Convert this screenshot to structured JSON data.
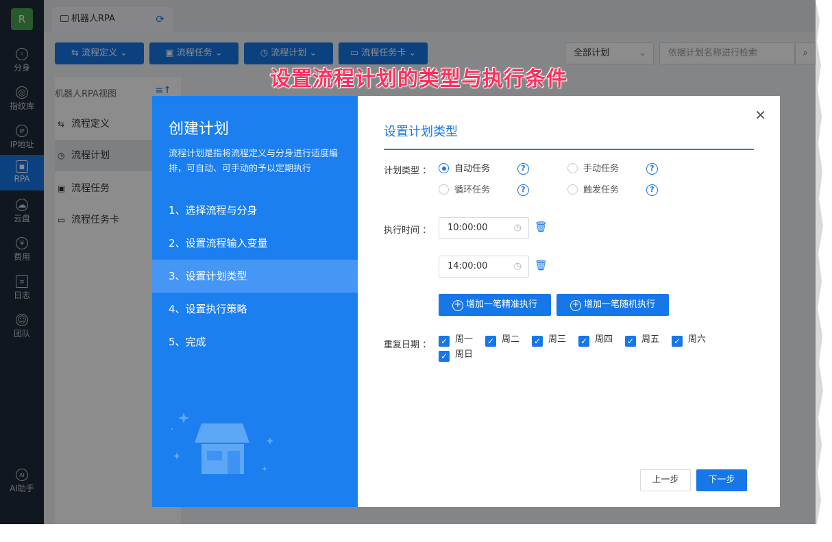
{
  "rail": {
    "logo": "R",
    "items": [
      {
        "label": "分身",
        "icon": "globe-icon"
      },
      {
        "label": "指纹库",
        "icon": "fingerprint-icon"
      },
      {
        "label": "IP地址",
        "icon": "ip-icon"
      },
      {
        "label": "RPA",
        "icon": "robot-icon",
        "active": true
      },
      {
        "label": "云盘",
        "icon": "cloud-icon"
      },
      {
        "label": "费用",
        "icon": "yen-icon"
      },
      {
        "label": "日志",
        "icon": "log-icon"
      },
      {
        "label": "团队",
        "icon": "team-icon"
      },
      {
        "label": "AI助手",
        "icon": "ai-icon"
      }
    ]
  },
  "tab": {
    "label": "机器人RPA"
  },
  "toolbar": {
    "flow_def": "流程定义",
    "flow_task": "流程任务",
    "flow_plan": "流程计划",
    "flow_card": "流程任务卡",
    "plan_filter": "全部计划",
    "search_placeholder": "依据计划名称进行检索"
  },
  "tree": {
    "title": "机器人RPA视图",
    "items": [
      "流程定义",
      "流程计划",
      "流程任务",
      "流程任务卡"
    ]
  },
  "banner": "设置流程计划的类型与执行条件",
  "modal": {
    "title": "创建计划",
    "desc": "流程计划是指将流程定义与分身进行适度编排，可自动、可手动的予以定期执行",
    "steps": [
      "1、选择流程与分身",
      "2、设置流程输入变量",
      "3、设置计划类型",
      "4、设置执行策略",
      "5、完成"
    ],
    "current_step": 3,
    "section_title": "设置计划类型",
    "plan_type_label": "计划类型",
    "plan_types": [
      {
        "label": "自动任务",
        "selected": true
      },
      {
        "label": "手动任务",
        "selected": false
      },
      {
        "label": "循环任务",
        "selected": false
      },
      {
        "label": "触发任务",
        "selected": false
      }
    ],
    "exec_time_label": "执行时间",
    "times": [
      "10:00:00",
      "14:00:00"
    ],
    "add_exact": "增加一笔精准执行",
    "add_random": "增加一笔随机执行",
    "repeat_label": "重复日期",
    "days": [
      {
        "label": "周一",
        "checked": true
      },
      {
        "label": "周二",
        "checked": true
      },
      {
        "label": "周三",
        "checked": true
      },
      {
        "label": "周四",
        "checked": true
      },
      {
        "label": "周五",
        "checked": true
      },
      {
        "label": "周六",
        "checked": true
      },
      {
        "label": "周日",
        "checked": true
      }
    ],
    "prev": "上一步",
    "next": "下一步"
  },
  "colors": {
    "accent": "#1677e8",
    "rail": "#1f2a37",
    "banner": "#ff2f5c"
  }
}
